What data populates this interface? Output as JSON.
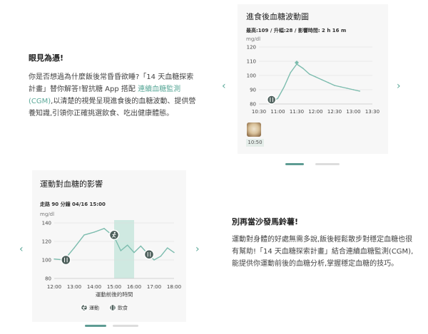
{
  "section1": {
    "heading": "眼見為憑!",
    "body_before": "你是否想過為什麼飯後常昏昏欲睡?「14 天血糖探索計畫」替你解答!智抗糖 App 搭配 ",
    "body_link": "連續血糖監測(CGM)",
    "body_after": ",以清楚的視覺呈現進食後的血糖波動、提供營養知識,引領你正確挑選飲食、吃出健康體態。",
    "prev_arrow": "‹",
    "next_arrow": "›",
    "pager": {
      "active": 1,
      "count": 2
    },
    "card": {
      "title": "進食後血糖波動圖",
      "meta": "最高:109 / 升幅:28 / 影響時間: 2 h 16 m",
      "unit": "mg/dl",
      "food_time": "10:50",
      "food_icon": "meal-photo"
    }
  },
  "section2": {
    "heading": "別再當沙發馬鈴薯!",
    "body": "運動對身體的好處無需多說,飯後輕鬆散步對穩定血糖也很有幫助!「14 天血糖探索計畫」結合連續血糖監測(CGM),能提供你運動前後的血糖分析,掌握穩定血糖的技巧。",
    "prev_arrow": "‹",
    "next_arrow": "›",
    "pager": {
      "active": 1,
      "count": 2
    },
    "card": {
      "title": "運動對血糖的影響",
      "meta": "走路 90 分鐘 04/16 15:00",
      "unit": "mg/dl"
    }
  },
  "colors": {
    "accent": "#5aa898",
    "line": "#7cbcae",
    "marker": "#4d5f5b",
    "highlight": "#cfe9e1",
    "grid": "#dddddd"
  },
  "chart_data": [
    {
      "type": "line",
      "title": "進食後血糖波動圖",
      "ylabel": "mg/dl",
      "x_ticks": [
        "10:30",
        "11:00",
        "11:30",
        "12:00",
        "12:30",
        "13:00",
        "13:30"
      ],
      "y_ticks": [
        80,
        90,
        100,
        110,
        120
      ],
      "ylim": [
        80,
        120
      ],
      "xlim": [
        "10:30",
        "13:30"
      ],
      "grid": true,
      "series": [
        {
          "x": [
            "10:50",
            "11:00",
            "11:10",
            "11:20",
            "11:30",
            "11:40",
            "11:50",
            "12:00",
            "12:10",
            "12:20",
            "12:30",
            "12:40",
            "12:50",
            "13:00",
            "13:10"
          ],
          "values": [
            81,
            84,
            92,
            102,
            108,
            105,
            101,
            99,
            97,
            95,
            93,
            92,
            91,
            90,
            89
          ]
        }
      ],
      "markers": [
        {
          "type": "meal",
          "x": "10:50",
          "y": 83
        },
        {
          "type": "peak",
          "x": "11:30",
          "y": 109
        }
      ]
    },
    {
      "type": "line",
      "title": "運動對血糖的影響",
      "xlabel": "運動前後的時間",
      "ylabel": "mg/dl",
      "x_ticks": [
        "12:00",
        "13:00",
        "14:00",
        "15:00",
        "16:00",
        "17:00",
        "18:00"
      ],
      "y_ticks": [
        80,
        100,
        120,
        140
      ],
      "ylim": [
        80,
        140
      ],
      "xlim": [
        "12:00",
        "18:00"
      ],
      "grid": true,
      "highlight_range": [
        "15:00",
        "16:00"
      ],
      "legend": [
        {
          "icon": "exercise",
          "label": "運動"
        },
        {
          "icon": "meal",
          "label": "飲食"
        }
      ],
      "series": [
        {
          "x": [
            "12:00",
            "12:30",
            "13:00",
            "13:30",
            "14:00",
            "14:30",
            "15:00",
            "15:20",
            "15:40",
            "16:00",
            "16:20",
            "16:40",
            "17:00",
            "17:20",
            "17:40",
            "18:00"
          ],
          "values": [
            101,
            100,
            113,
            127,
            130,
            134,
            125,
            110,
            116,
            108,
            115,
            107,
            100,
            104,
            113,
            108
          ]
        }
      ],
      "markers": [
        {
          "type": "meal",
          "x": "12:35",
          "y": 100
        },
        {
          "type": "exercise",
          "x": "15:00",
          "y": 127
        },
        {
          "type": "meal",
          "x": "16:45",
          "y": 106
        }
      ]
    }
  ]
}
